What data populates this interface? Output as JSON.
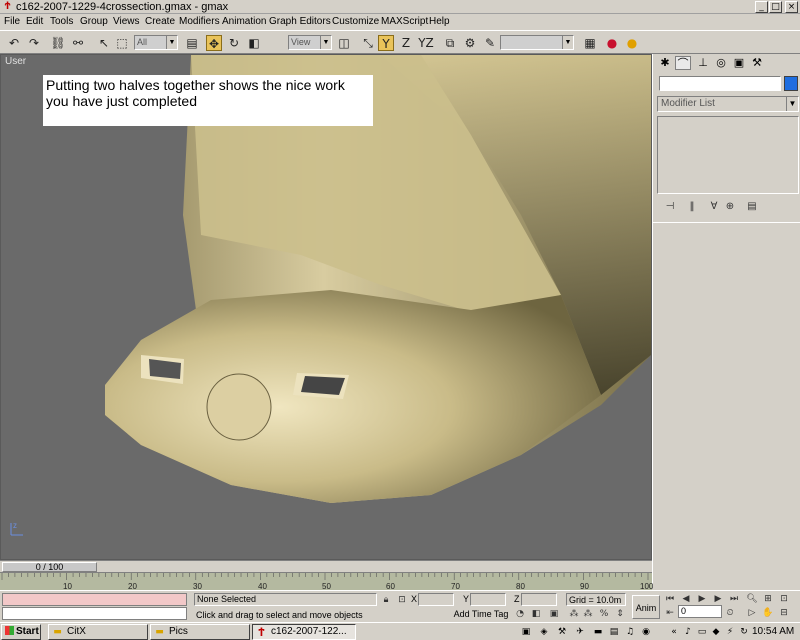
{
  "window": {
    "title": "c162-2007-1229-4crossection.gmax - gmax",
    "app_icon": "gmax-logo-icon",
    "minimize": "_",
    "maximize": "□",
    "close": "×"
  },
  "menu": {
    "items": [
      "File",
      "Edit",
      "Tools",
      "Group",
      "Views",
      "Create",
      "Modifiers",
      "Animation",
      "Graph Editors",
      "Customize",
      "MAXScript",
      "Help"
    ]
  },
  "toolbar": {
    "selection_filter": "All",
    "reference_coord": "View",
    "named_selection": "",
    "icons": [
      "undo-icon",
      "redo-icon",
      "link-icon",
      "unlink-icon",
      "select-icon",
      "region-select-icon",
      "select-by-name-icon",
      "move-icon",
      "rotate-icon",
      "scale-icon",
      "pivot-icon",
      "mirror-icon",
      "constrain-y-icon",
      "constrain-z-icon",
      "constrain-yz-icon",
      "align-icon",
      "snap-icon",
      "material-editor-icon",
      "render-icon",
      "quick-render-icon"
    ],
    "constraint_labels": {
      "x": "X",
      "y": "Y",
      "z": "Z",
      "yz": "YZ"
    }
  },
  "viewport": {
    "label": "User",
    "annotation_line1": "Putting two halves together shows the nice work",
    "annotation_line2": "you have just completed",
    "model_color": "#cfc39a"
  },
  "command_panel": {
    "tabs": [
      "create-tab-icon",
      "modify-tab-icon",
      "hierarchy-tab-icon",
      "motion-tab-icon",
      "display-tab-icon",
      "utilities-tab-icon"
    ],
    "object_name": "",
    "object_color": "#1e6ee0",
    "modifier_list": "Modifier List",
    "stack_buttons": [
      "pin-stack-icon",
      "show-end-result-icon",
      "make-unique-icon",
      "remove-modifier-icon",
      "configure-sets-icon"
    ]
  },
  "timeline": {
    "slider_label": "0 / 100",
    "current_frame": 0,
    "total_frames": 100,
    "tick_labels": [
      "10",
      "20",
      "30",
      "40",
      "50",
      "60",
      "70",
      "80",
      "90",
      "100"
    ]
  },
  "status": {
    "selection": "None Selected",
    "prompt": "Click and drag to select and move objects",
    "coord_x_label": "X",
    "coord_y_label": "Y",
    "coord_z_label": "Z",
    "grid": "Grid = 10.0m",
    "add_time_tag": "Add Time Tag",
    "anim_button": "Anim",
    "frame_value": "0"
  },
  "taskbar": {
    "start": "Start",
    "tasks": [
      {
        "label": "CitX",
        "icon": "folder-icon",
        "active": false
      },
      {
        "label": "Pics",
        "icon": "folder-icon",
        "active": false
      },
      {
        "label": "c162-2007-122...",
        "icon": "gmax-logo-icon",
        "active": true
      }
    ],
    "clock": "10:54 AM"
  }
}
